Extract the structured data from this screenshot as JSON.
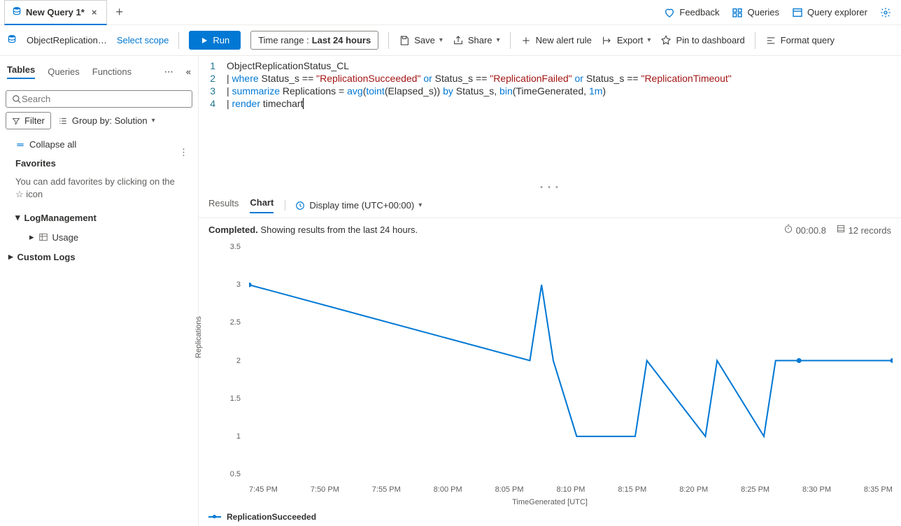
{
  "tab": {
    "title": "New Query 1*",
    "close": "×"
  },
  "rightLinks": {
    "feedback": "Feedback",
    "queries": "Queries",
    "explorer": "Query explorer"
  },
  "toolbar": {
    "scope": "ObjectReplication…",
    "selectScope": "Select scope",
    "run": "Run",
    "timeRange": {
      "label": "Time range :",
      "value": "Last 24 hours"
    },
    "save": "Save",
    "share": "Share",
    "newAlert": "New alert rule",
    "export": "Export",
    "pin": "Pin to dashboard",
    "format": "Format query"
  },
  "sidebar": {
    "tabs": [
      "Tables",
      "Queries",
      "Functions"
    ],
    "searchPlaceholder": "Search",
    "filter": "Filter",
    "groupBy": "Group by: Solution",
    "collapseAll": "Collapse all",
    "favorites": "Favorites",
    "favInfo": "You can add favorites by clicking on the ☆ icon",
    "logMgmt": "LogManagement",
    "usage": "Usage",
    "customLogs": "Custom Logs"
  },
  "code": {
    "l1": "ObjectReplicationStatus_CL",
    "l2a": "| ",
    "l2b": "where",
    "l2c": " Status_s == ",
    "l2d": "\"ReplicationSucceeded\"",
    "l2e": " or ",
    "l2f": "Status_s == ",
    "l2g": "\"ReplicationFailed\"",
    "l2h": " or ",
    "l2i": "Status_s == ",
    "l2j": "\"ReplicationTimeout\"",
    "l3a": "| ",
    "l3b": "summarize",
    "l3c": " Replications = ",
    "l3d": "avg",
    "l3e": "(",
    "l3f": "toint",
    "l3g": "(Elapsed_s)) ",
    "l3h": "by",
    "l3i": " Status_s, ",
    "l3j": "bin",
    "l3k": "(TimeGenerated, ",
    "l3l": "1m",
    "l4a": "| ",
    "l4b": "render",
    "l4c": " timechart",
    "paren": ")"
  },
  "results": {
    "tabs": {
      "results": "Results",
      "chart": "Chart"
    },
    "displayTime": "Display time (UTC+00:00)",
    "completed": "Completed.",
    "showing": "Showing results from the last 24 hours.",
    "timing": "00:00.8",
    "records": "12 records"
  },
  "chart_data": {
    "type": "line",
    "title": "",
    "xlabel": "TimeGenerated [UTC]",
    "ylabel": "Replications",
    "ylim": [
      0.5,
      3.5
    ],
    "categories": [
      "7:45 PM",
      "7:50 PM",
      "7:55 PM",
      "8:00 PM",
      "8:05 PM",
      "8:10 PM",
      "8:15 PM",
      "8:20 PM",
      "8:25 PM",
      "8:30 PM",
      "8:35 PM"
    ],
    "series": [
      {
        "name": "ReplicationSucceeded",
        "x": [
          "7:43 PM",
          "8:07 PM",
          "8:08 PM",
          "8:09 PM",
          "8:11 PM",
          "8:16 PM",
          "8:17 PM",
          "8:22 PM",
          "8:23 PM",
          "8:27 PM",
          "8:28 PM",
          "8:30 PM",
          "8:38 PM"
        ],
        "values": [
          3,
          2,
          3,
          2,
          1,
          1,
          2,
          1,
          2,
          1,
          2,
          2,
          2
        ]
      }
    ]
  }
}
